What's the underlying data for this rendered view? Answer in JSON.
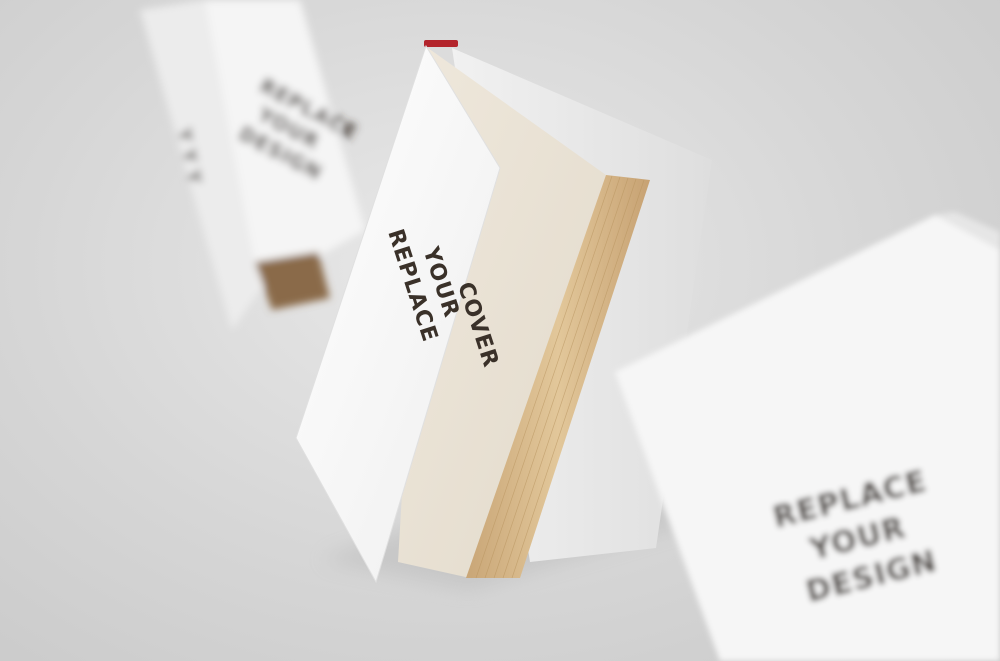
{
  "scene": {
    "background_color": "#d9d9d9",
    "back_book": {
      "lines": [
        "REPLACE",
        "YOUR",
        "DESIGN"
      ],
      "spine_text": "Y Y Y"
    },
    "center_book": {
      "lines": [
        "REPLACE",
        "YOUR",
        "COVER"
      ],
      "text_color": "#3a3129",
      "page_edge_color": "#d8b98a",
      "bookmark_color": "#b3242b"
    },
    "front_book": {
      "lines": [
        "REPLACE",
        "YOUR",
        "DESIGN"
      ]
    }
  }
}
